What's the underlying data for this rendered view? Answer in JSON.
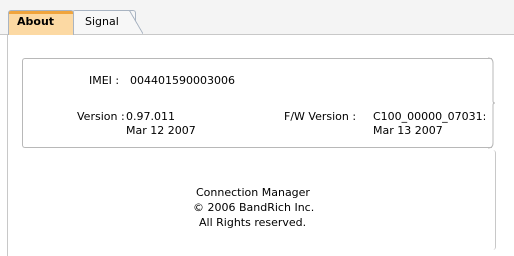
{
  "tabs": [
    {
      "label": "About",
      "active": true
    },
    {
      "label": "Signal",
      "active": false
    }
  ],
  "device": {
    "imei_label": "IMEI :",
    "imei_value": "004401590003006",
    "version_label": "Version :",
    "version_value": "0.97.011",
    "version_date": "Mar 12 2007",
    "fw_label": "F/W Version :",
    "fw_value": "C100_00000_07031:",
    "fw_date": "Mar 13 2007"
  },
  "about": {
    "product": "Connection Manager",
    "copyright": "© 2006 BandRich Inc.",
    "rights": "All Rights reserved."
  },
  "colors": {
    "active_tab": "#fcd9a3",
    "active_tab_accent": "#f0a43c",
    "border": "#b8b8b8"
  }
}
